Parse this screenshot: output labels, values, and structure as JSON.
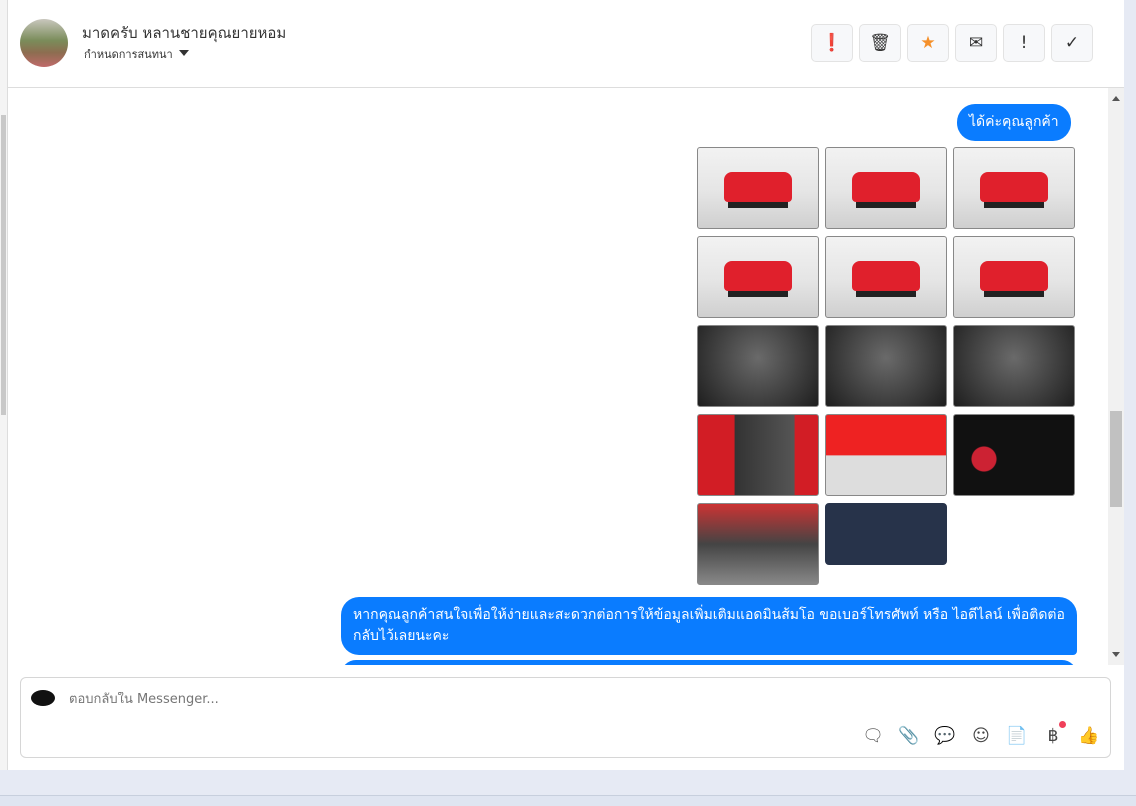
{
  "header": {
    "name": "มาดครับ หลานชายคุณยายหอม",
    "subtitle": "กำหนดการสนทนา",
    "actions": [
      {
        "icon": "alert-circle-icon",
        "glyph": "❗"
      },
      {
        "icon": "trash-icon",
        "glyph": "🗑"
      },
      {
        "icon": "star-icon",
        "glyph": "★",
        "color": "#f5902a"
      },
      {
        "icon": "mail-icon",
        "glyph": "✉"
      },
      {
        "icon": "exclamation-icon",
        "glyph": "!"
      },
      {
        "icon": "check-icon",
        "glyph": "✓"
      }
    ]
  },
  "messages": [
    {
      "text": "ได้ค่ะคุณลูกค้า"
    },
    {
      "text": "หากคุณลูกค้าสนใจเพื่อให้ง่ายและสะดวกต่อการให้ข้อมูลเพิ่มเติมแอดมินส้มโอ ขอเบอร์โทรศัพท์ หรือ ไอดีไลน์ เพื่อติดต่อกลับไว้เลยนะคะ"
    }
  ],
  "composer": {
    "placeholder": "ตอบกลับใน Messenger...",
    "tools": [
      "saved-reply-icon",
      "attachment-icon",
      "chat-icon",
      "emoji-icon",
      "document-icon",
      "baht-icon",
      "like-icon"
    ],
    "tool_glyphs": [
      "🗨",
      "📎",
      "💬",
      "☺",
      "📄",
      "฿",
      "👍"
    ]
  },
  "colors": {
    "accent": "#0a7cff"
  }
}
